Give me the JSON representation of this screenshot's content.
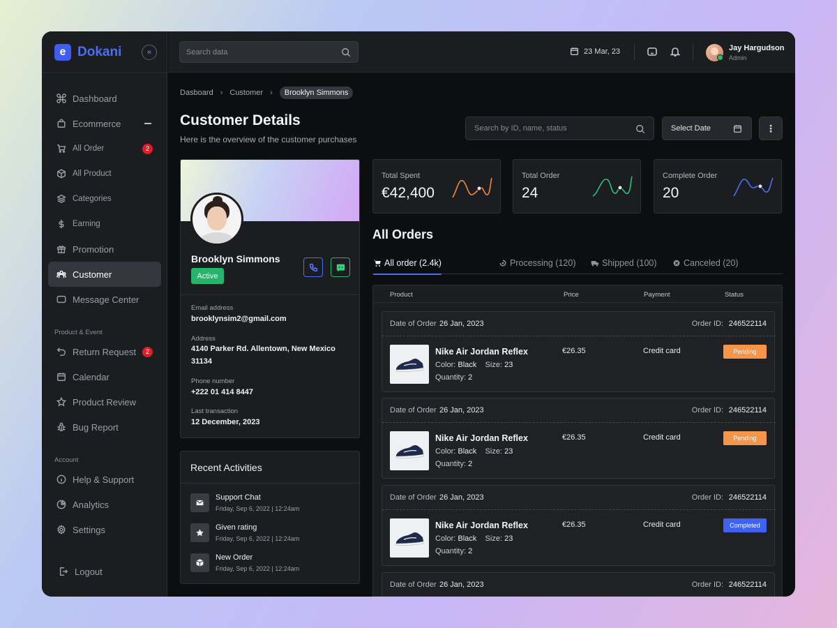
{
  "brand": {
    "logo_letter": "e",
    "name": "Dokani"
  },
  "sidebar": {
    "items": [
      {
        "label": "Dashboard",
        "icon": "command-icon"
      },
      {
        "label": "Ecommerce",
        "icon": "bag-icon"
      },
      {
        "label": "All Order",
        "icon": "cart-icon",
        "badge": "2"
      },
      {
        "label": "All Product",
        "icon": "box-icon"
      },
      {
        "label": "Categories",
        "icon": "layers-icon"
      },
      {
        "label": "Earning",
        "icon": "dollar-icon"
      },
      {
        "label": "Promotion",
        "icon": "gift-icon"
      },
      {
        "label": "Customer",
        "icon": "users-icon"
      },
      {
        "label": "Message Center",
        "icon": "message-icon"
      }
    ],
    "section_product": "Product & Event",
    "product_items": [
      {
        "label": "Return Request",
        "icon": "return-icon",
        "badge": "2"
      },
      {
        "label": "Calendar",
        "icon": "calendar-icon"
      },
      {
        "label": "Product Review",
        "icon": "star-icon"
      },
      {
        "label": "Bug Report",
        "icon": "bug-icon"
      }
    ],
    "section_account": "Account",
    "account_items": [
      {
        "label": "Help & Support",
        "icon": "info-icon"
      },
      {
        "label": "Analytics",
        "icon": "pie-icon"
      },
      {
        "label": "Settings",
        "icon": "gear-icon"
      }
    ],
    "logout": "Logout"
  },
  "topbar": {
    "search_placeholder": "Search data",
    "date": "23 Mar, 23",
    "user_name": "Jay Hargudson",
    "user_role": "Admin"
  },
  "breadcrumb": [
    "Dasboard",
    "Customer",
    "Brooklyn Simmons"
  ],
  "page": {
    "title": "Customer Details",
    "subtitle": "Here is the overview of the customer purchases",
    "search_placeholder": "Search by ID, name, status",
    "select_date": "Select Date",
    "more": "⋮"
  },
  "profile": {
    "name": "Brooklyn Simmons",
    "status": "Active",
    "email_label": "Email address",
    "email": "brooklynsim2@gmail.com",
    "address_label": "Address",
    "address": "4140 Parker Rd. Allentown, New Mexico 31134",
    "phone_label": "Phone number",
    "phone": "+222 01 414 8447",
    "last_label": "Last transaction",
    "last": "12 December, 2023"
  },
  "activities": {
    "title": "Recent Activities",
    "items": [
      {
        "name": "Support Chat",
        "time": "Friday, Sep 6, 2022  |  12:24am",
        "icon": "mail-icon"
      },
      {
        "name": "Given rating",
        "time": "Friday, Sep 6, 2022  |  12:24am",
        "icon": "star-icon"
      },
      {
        "name": "New Order",
        "time": "Friday, Sep 6, 2022  |  12:24am",
        "icon": "package-icon"
      }
    ]
  },
  "stats": [
    {
      "label": "Total Spent",
      "value": "€42,400",
      "color": "#f08a3c"
    },
    {
      "label": "Total Order",
      "value": "24",
      "color": "#2fc07a"
    },
    {
      "label": "Complete Order",
      "value": "20",
      "color": "#4c6ef5"
    }
  ],
  "orders": {
    "title": "All Orders",
    "tabs": [
      {
        "label": "All order (2.4k)",
        "icon": "cart-icon"
      },
      {
        "label": "Processing (120)",
        "icon": "processing-icon"
      },
      {
        "label": "Shipped (100)",
        "icon": "truck-icon"
      },
      {
        "label": "Canceled (20)",
        "icon": "cancel-icon"
      }
    ],
    "columns": [
      "Product",
      "Price",
      "Payment",
      "Status"
    ],
    "date_label": "Date of Order",
    "id_label": "Order ID:",
    "color_label": "Color:",
    "size_label": "Size:",
    "qty_label": "Quantity:",
    "rows": [
      {
        "date": "26 Jan, 2023",
        "id": "246522114",
        "name": "Nike Air Jordan Reflex",
        "color": "Black",
        "size": "23",
        "qty": "2",
        "price": "€26.35",
        "payment": "Credit card",
        "status": "Pending",
        "status_color": "#f5954a"
      },
      {
        "date": "26 Jan, 2023",
        "id": "246522114",
        "name": "Nike Air Jordan Reflex",
        "color": "Black",
        "size": "23",
        "qty": "2",
        "price": "€26.35",
        "payment": "Credit card",
        "status": "Pending",
        "status_color": "#f5954a"
      },
      {
        "date": "26 Jan, 2023",
        "id": "246522114",
        "name": "Nike Air Jordan Reflex",
        "color": "Black",
        "size": "23",
        "qty": "2",
        "price": "€26.35",
        "payment": "Credit card",
        "status": "Completed",
        "status_color": "#3f63f0"
      },
      {
        "date": "26 Jan, 2023",
        "id": "246522114"
      }
    ]
  }
}
